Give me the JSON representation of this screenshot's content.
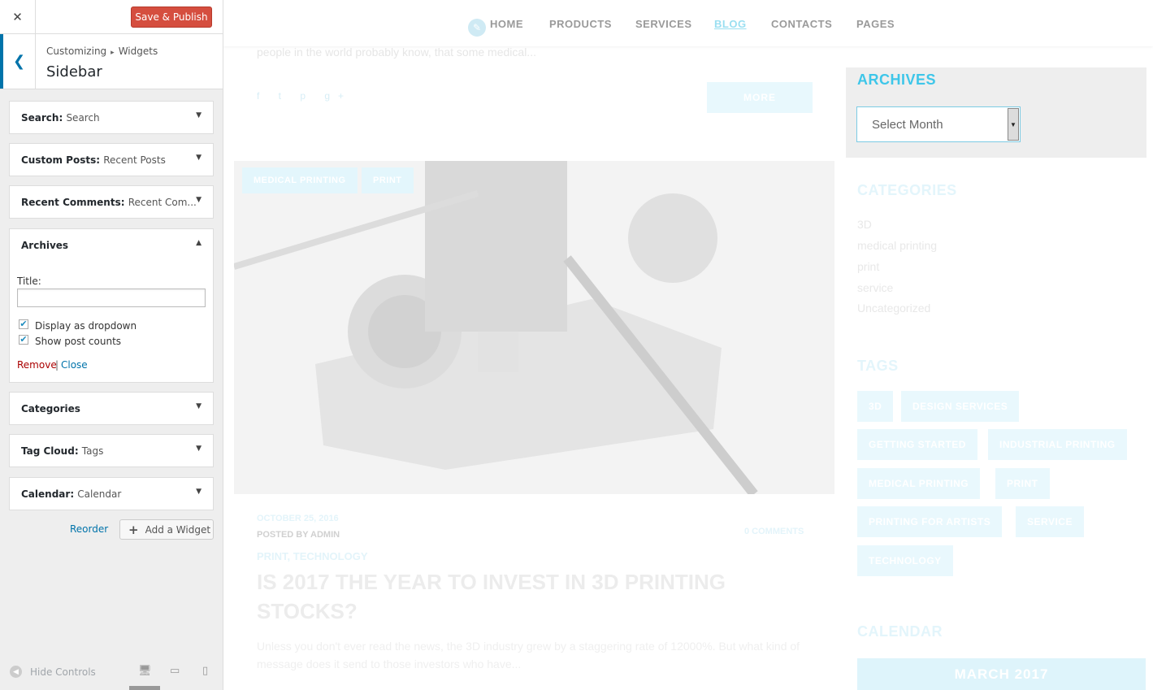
{
  "customizer": {
    "close_label": "✕",
    "save_label": "Save & Publish",
    "breadcrumb": {
      "parent": "Customizing",
      "child": "Widgets"
    },
    "section_title": "Sidebar",
    "widgets": [
      {
        "type": "Search",
        "title": "Search"
      },
      {
        "type": "Custom Posts",
        "title": "Recent Posts"
      },
      {
        "type": "Recent Comments",
        "title": "Recent Com..."
      },
      {
        "type": "Archives",
        "title": ""
      },
      {
        "type": "Categories",
        "title": ""
      },
      {
        "type": "Tag Cloud",
        "title": "Tags"
      },
      {
        "type": "Calendar",
        "title": "Calendar"
      }
    ],
    "archives_form": {
      "title_label": "Title:",
      "title_value": "",
      "dropdown_label": "Display as dropdown",
      "dropdown_checked": true,
      "counts_label": "Show post counts",
      "counts_checked": true,
      "remove_label": "Remove",
      "separator": "|",
      "close_label": "Close"
    },
    "reorder_label": "Reorder",
    "add_widget_label": "Add a Widget",
    "hide_controls_label": "Hide Controls",
    "colors": {
      "accent": "#0073aa",
      "save": "#d54e3f",
      "remove": "#aa0000"
    }
  },
  "preview": {
    "nav": [
      "HOME",
      "PRODUCTS",
      "SERVICES",
      "BLOG",
      "CONTACTS",
      "PAGES"
    ],
    "nav_active": "BLOG",
    "prev_excerpt": "people in the world probably know, that some medical...",
    "more_label": "MORE",
    "post_tags": [
      "MEDICAL PRINTING",
      "PRINT"
    ],
    "post_date": "OCTOBER 25, 2016",
    "posted_by": "POSTED BY ADMIN",
    "comments": "0 COMMENTS",
    "categories_line": "PRINT, TECHNOLOGY",
    "post_title": "IS 2017 THE YEAR TO INVEST IN 3D PRINTING STOCKS?",
    "post_excerpt": "Unless you don't ever read the news, the 3D industry grew by a staggering rate of 12000%. But what kind of message does it send to those investors who have...",
    "sidebar": {
      "archives_title": "ARCHIVES",
      "archives_select": "Select Month",
      "categories_title": "CATEGORIES",
      "categories": [
        "3D",
        "medical printing",
        "print",
        "service",
        "Uncategorized"
      ],
      "tags_title": "TAGS",
      "tags": [
        "3D",
        "DESIGN SERVICES",
        "GETTING STARTED",
        "INDUSTRIAL PRINTING",
        "MEDICAL PRINTING",
        "PRINT",
        "PRINTING FOR ARTISTS",
        "SERVICE",
        "TECHNOLOGY"
      ],
      "calendar_title": "CALENDAR",
      "calendar_month": "MARCH 2017"
    },
    "colors": {
      "accent": "#3ec6e9"
    }
  }
}
